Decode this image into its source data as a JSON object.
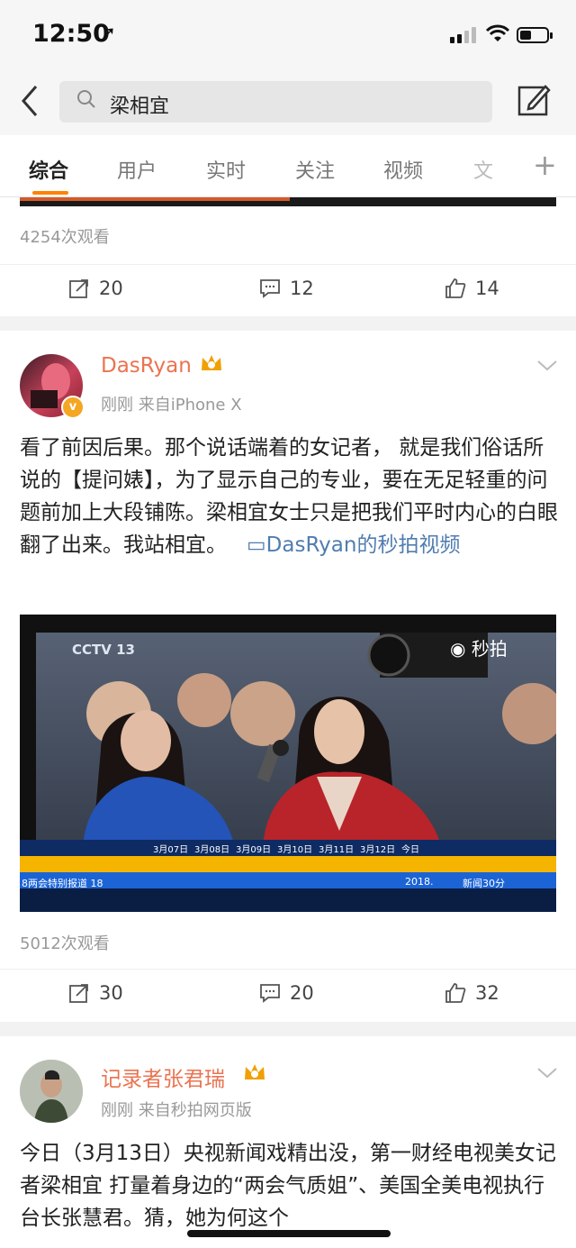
{
  "status": {
    "time": "12:50",
    "location_icon": "location-arrow-icon"
  },
  "search": {
    "query": "梁相宜",
    "back_icon": "chevron-left-icon",
    "edit_icon": "compose-icon"
  },
  "tabs": [
    {
      "label": "综合",
      "active": true
    },
    {
      "label": "用户"
    },
    {
      "label": "实时"
    },
    {
      "label": "关注"
    },
    {
      "label": "视频"
    },
    {
      "label": "文"
    }
  ],
  "tabs_more": "+",
  "post1": {
    "views": "4254次观看",
    "repost": "20",
    "comment": "12",
    "like": "14"
  },
  "post2": {
    "user": "DasRyan",
    "meta": "刚刚  来自iPhone X",
    "text": "看了前因后果。那个说话端着的女记者， 就是我们俗话所说的【提问婊】，为了显示自己的专业，要在无足轻重的问题前加上大段铺陈。梁相宜女士只是把我们平时内心的白眼翻了出来。我站相宜。",
    "link": "DasRyan的秒拍视频",
    "video": {
      "channel": "CCTV 13",
      "watermark": "秒拍",
      "dates": [
        "3月07日",
        "3月08日",
        "3月09日",
        "3月10日",
        "3月11日",
        "3月12日",
        "今日"
      ],
      "ticker": "8两会特别报道 18",
      "ticker_year": "2018.",
      "ticker_right": "新闻30分"
    },
    "views": "5012次观看",
    "repost": "30",
    "comment": "20",
    "like": "32"
  },
  "post3": {
    "user": "记录者张君瑞",
    "meta": "刚刚  来自秒拍网页版",
    "text": "今日（3月13日）央视新闻戏精出没，第一财经电视美女记者梁相宜 打量着身边的“两会气质姐”、美国全美电视执行台长张慧君。猜，她为何这个"
  },
  "colors": {
    "accent": "#ff8200",
    "username": "#eb7350",
    "link": "#507daf"
  }
}
